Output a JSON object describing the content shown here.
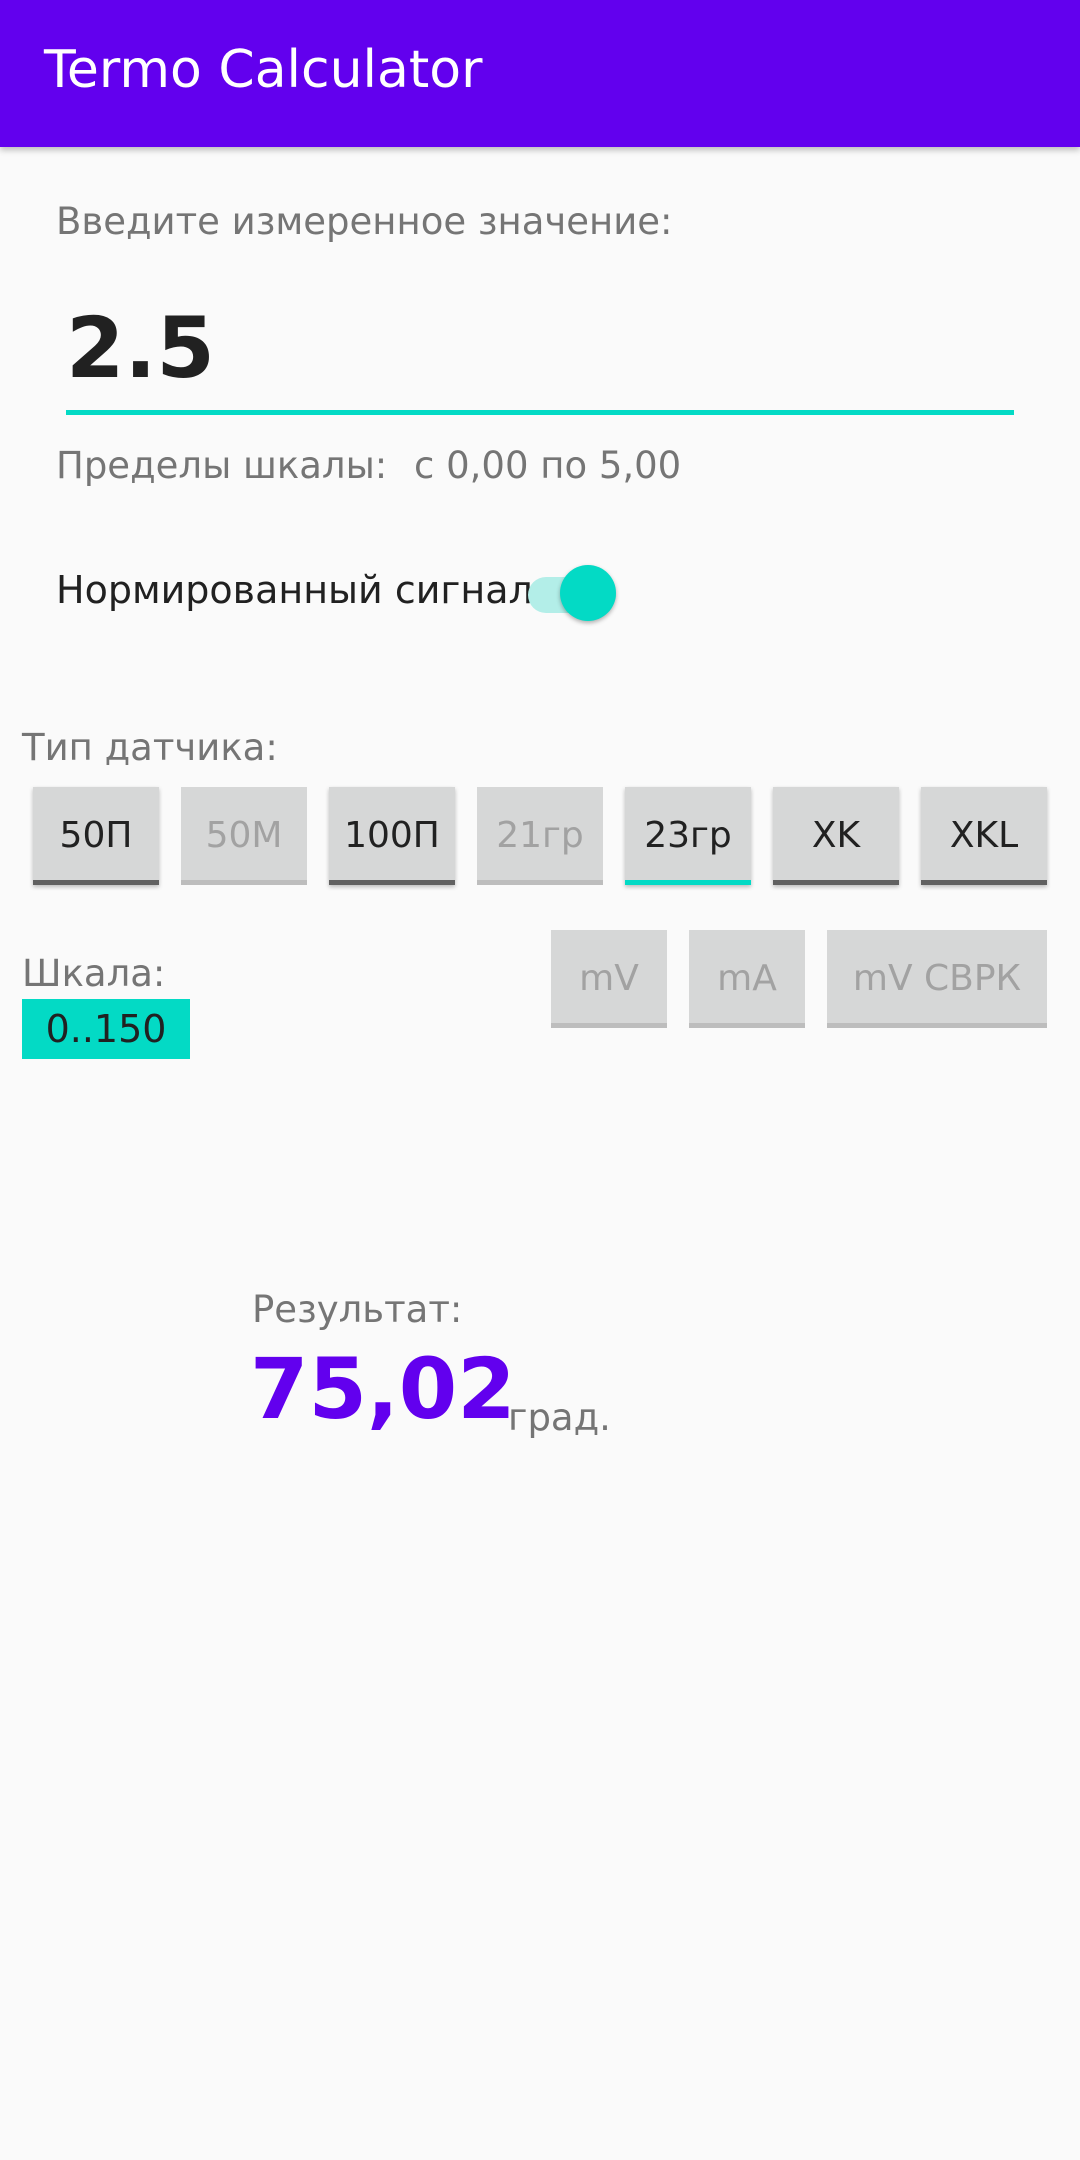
{
  "app_bar": {
    "title": "Termo Calculator",
    "color": "#6200EE"
  },
  "input": {
    "label": "Введите измеренное значение:",
    "value": "2.5",
    "accent_color": "#03DAC5"
  },
  "scale_limits": {
    "label": "Пределы шкалы:",
    "value": "с 0,00 по 5,00"
  },
  "normalized_signal": {
    "label": "Нормированный сигнал",
    "checked": true
  },
  "sensor_type": {
    "label": "Тип датчика:",
    "buttons": [
      {
        "label": "50П",
        "state": "enabled"
      },
      {
        "label": "50М",
        "state": "disabled"
      },
      {
        "label": "100П",
        "state": "enabled"
      },
      {
        "label": "21гр",
        "state": "disabled"
      },
      {
        "label": "23гр",
        "state": "selected"
      },
      {
        "label": "XK",
        "state": "enabled"
      },
      {
        "label": "XKL",
        "state": "enabled"
      }
    ]
  },
  "scale": {
    "label": "Шкала:",
    "value": "0..150"
  },
  "unit_buttons": [
    {
      "label": "mV",
      "state": "disabled"
    },
    {
      "label": "mA",
      "state": "disabled"
    },
    {
      "label": "mV СВРК",
      "state": "disabled"
    }
  ],
  "result": {
    "label": "Результат:",
    "value": "75,02",
    "unit": "град.",
    "color": "#6200EE"
  }
}
